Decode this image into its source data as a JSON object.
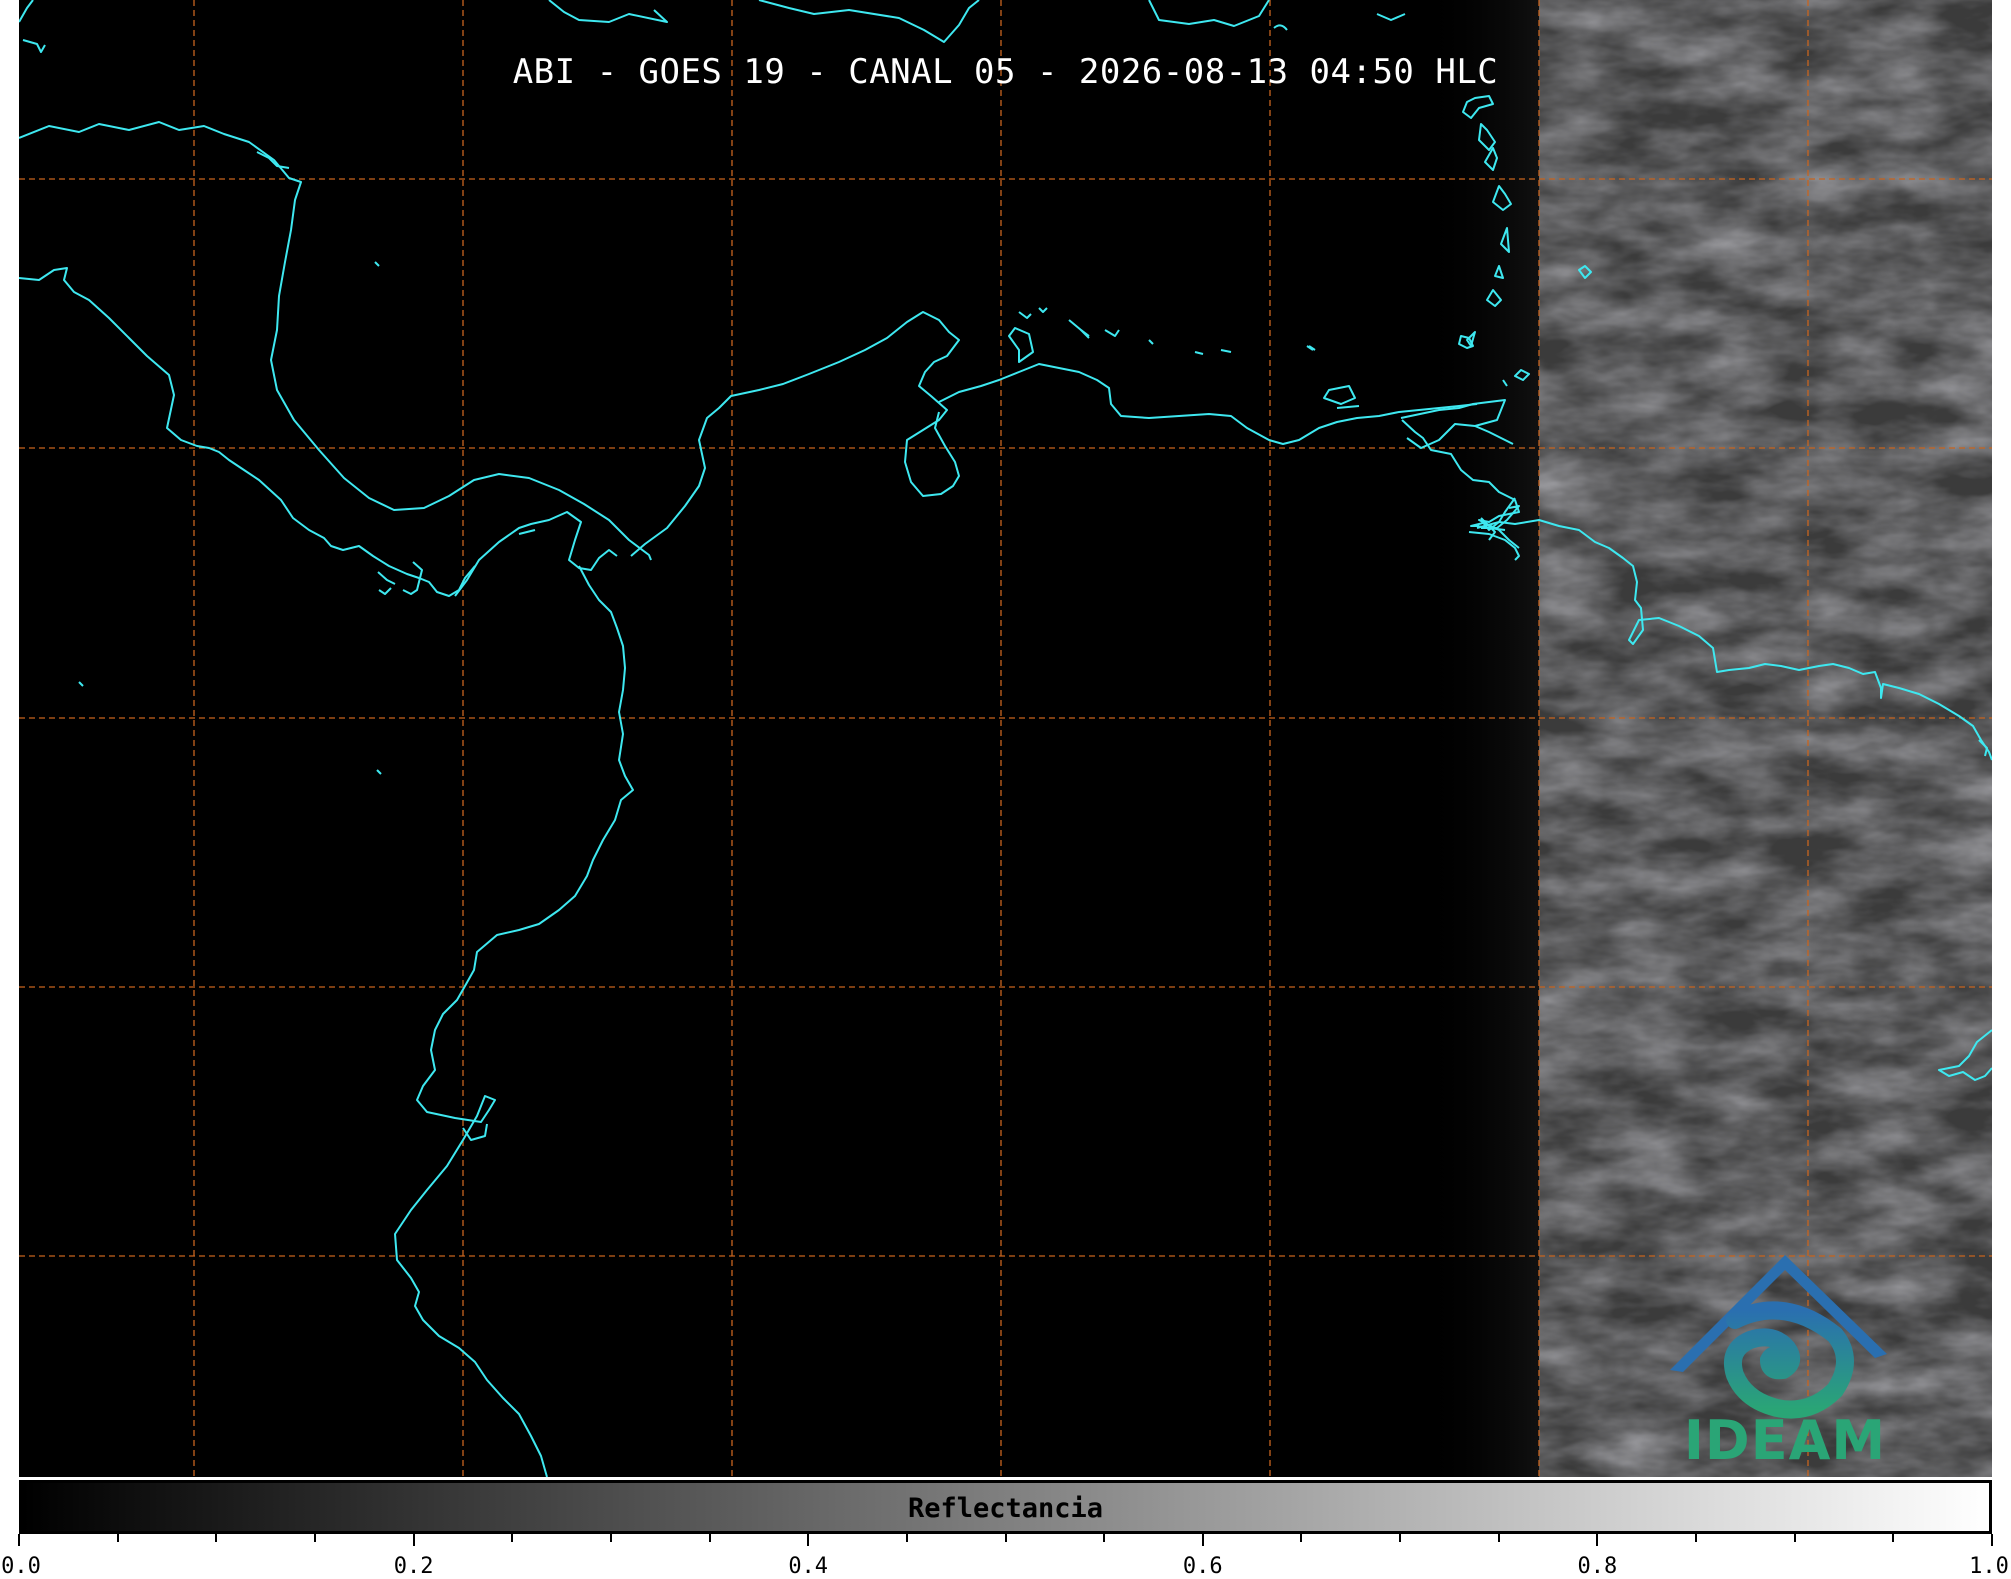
{
  "title": "ABI - GOES 19 - CANAL 05 - 2026-08-13 04:50 HLC",
  "colorbar": {
    "label": "Reflectancia",
    "min": 0.0,
    "max": 1.0,
    "gradient": [
      "#000000",
      "#ffffff"
    ],
    "tick_labels": [
      "0.0",
      "0.2",
      "0.4",
      "0.6",
      "0.8",
      "1.0"
    ]
  },
  "logo": {
    "text": "IDEAM",
    "colors": {
      "blue": "#2a6fb0",
      "green": "#2aa576"
    }
  },
  "colors": {
    "background": "#000000",
    "coastline": "#3ee8f0",
    "gridlines": "#c8641e",
    "clouds": "#4a4a4a"
  },
  "map": {
    "gridlines": "dashed",
    "coastlines": true,
    "gridline_spacing_deg": 5
  }
}
